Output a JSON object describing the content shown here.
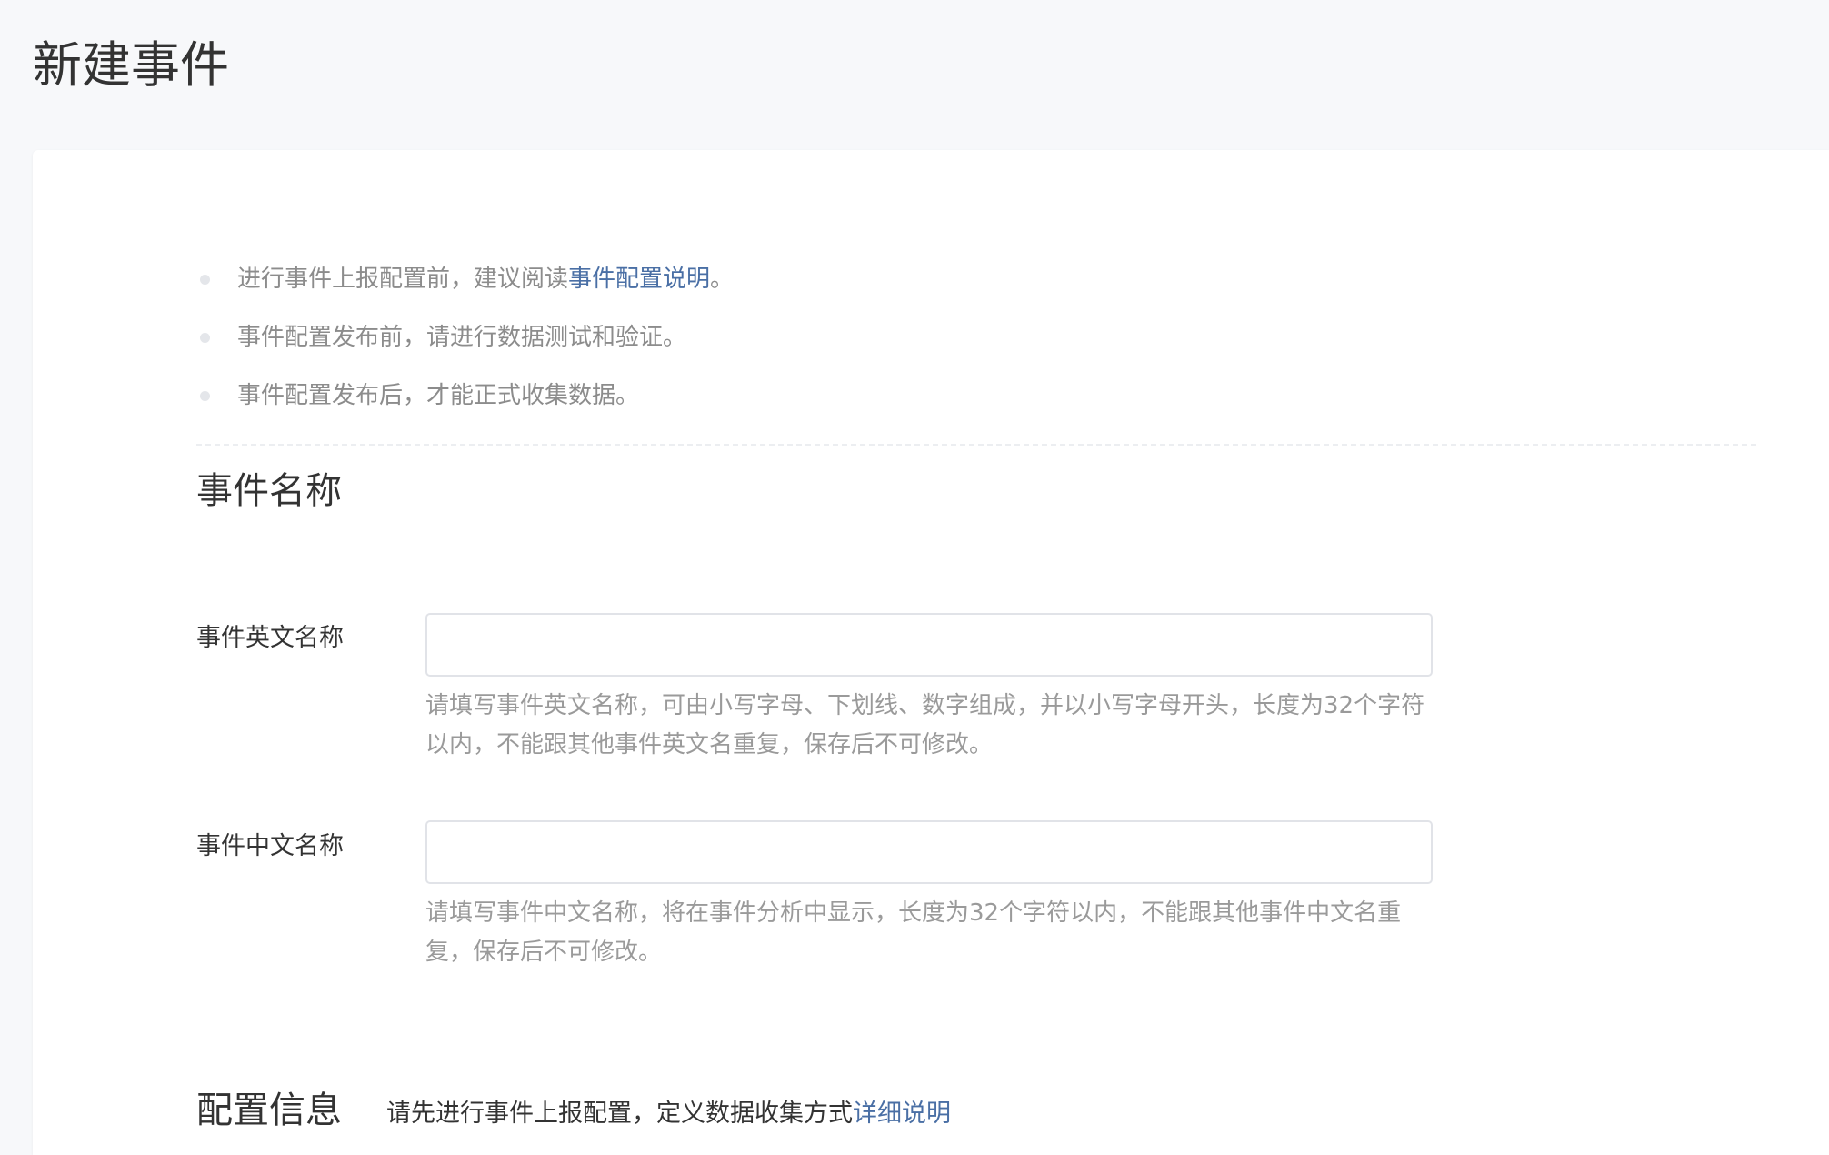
{
  "page": {
    "title": "新建事件"
  },
  "tips": {
    "item1_prefix": "进行事件上报配置前，建议阅读",
    "item1_link": "事件配置说明",
    "item1_suffix": "。",
    "item2": "事件配置发布前，请进行数据测试和验证。",
    "item3": "事件配置发布后，才能正式收集数据。"
  },
  "event_name_section": {
    "title": "事件名称",
    "english_name": {
      "label": "事件英文名称",
      "value": "",
      "hint": "请填写事件英文名称，可由小写字母、下划线、数字组成，并以小写字母开头，长度为32个字符以内，不能跟其他事件英文名重复，保存后不可修改。"
    },
    "chinese_name": {
      "label": "事件中文名称",
      "value": "",
      "hint": "请填写事件中文名称，将在事件分析中显示，长度为32个字符以内，不能跟其他事件中文名重复，保存后不可修改。"
    }
  },
  "config_section": {
    "title": "配置信息",
    "description": "请先进行事件上报配置，定义数据收集方式",
    "link": "详细说明"
  },
  "colors": {
    "background": "#f7f8fa",
    "card": "#ffffff",
    "link": "#4a6fa5",
    "hint_text": "#9a9a9a",
    "tip_text": "#8c8c8c"
  }
}
